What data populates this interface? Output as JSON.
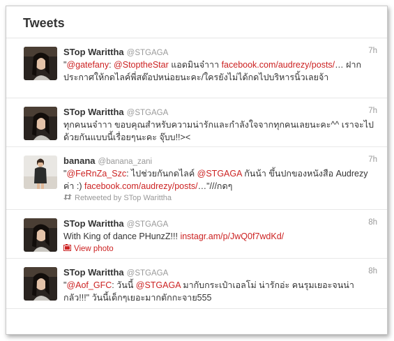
{
  "header": {
    "title": "Tweets"
  },
  "colors": {
    "link": "#cc2222",
    "text": "#333333",
    "muted": "#999999"
  },
  "tweets": [
    {
      "fullname": "STop Warittha",
      "username": "@STGAGA",
      "time": "7h",
      "avatar": "woman-portrait-dark",
      "parts": [
        {
          "t": "\"",
          "link": false
        },
        {
          "t": "@gatefany",
          "link": true
        },
        {
          "t": ": ",
          "link": false
        },
        {
          "t": "@StoptheStar",
          "link": true
        },
        {
          "t": " แอดมินจ๋าาา ",
          "link": false
        },
        {
          "t": "facebook.com/audrezy/posts/",
          "link": true
        },
        {
          "t": "… ฝากประกาศให้กดไลค์พี่สต๊อปหน่อยนะคะ/ใครยังไม่ได้กดไปบริหารนิ้วเลยจ้า",
          "link": false
        }
      ]
    },
    {
      "fullname": "STop Warittha",
      "username": "@STGAGA",
      "time": "7h",
      "avatar": "woman-portrait-dark",
      "parts": [
        {
          "t": "ทุกคนนจ๋าาา ขอบคุณสำหรับความน่ารักและกำลังใจจากทุกคนเลยนะคะ^^ เราจะไปด้วยกันแบบนี้เรื่อยๆนะคะ จุ๊บบ!!><",
          "link": false
        }
      ]
    },
    {
      "fullname": "banana",
      "username": "@banana_zani",
      "time": "7h",
      "avatar": "woman-standing",
      "parts": [
        {
          "t": "\"",
          "link": false
        },
        {
          "t": "@FeRnZa_Szc",
          "link": true
        },
        {
          "t": ": ไปช่วยกันกดไลค์ ",
          "link": false
        },
        {
          "t": "@STGAGA",
          "link": true
        },
        {
          "t": " กันน้า ขึ้นปกของหนังสือ Audrezy ค่า :) ",
          "link": false
        },
        {
          "t": "facebook.com/audrezy/posts/",
          "link": true
        },
        {
          "t": "…\"///กดๆ",
          "link": false
        }
      ],
      "meta": {
        "type": "retweet",
        "label": "Retweeted by STop Warittha",
        "icon": "retweet-icon"
      }
    },
    {
      "fullname": "STop Warittha",
      "username": "@STGAGA",
      "time": "8h",
      "avatar": "woman-portrait-dark",
      "parts": [
        {
          "t": "With King of dance PHunzZ!!! ",
          "link": false
        },
        {
          "t": "instagr.am/p/JwQ0f7wdKd/",
          "link": true
        }
      ],
      "meta": {
        "type": "photo",
        "label": "View photo",
        "icon": "photo-icon"
      }
    },
    {
      "fullname": "STop Warittha",
      "username": "@STGAGA",
      "time": "8h",
      "avatar": "woman-portrait-dark",
      "parts": [
        {
          "t": "\"",
          "link": false
        },
        {
          "t": "@Aof_GFC",
          "link": true
        },
        {
          "t": ": วันนี้ ",
          "link": false
        },
        {
          "t": "@STGAGA",
          "link": true
        },
        {
          "t": " มากับกระเป๋าเอลโม่ น่ารักอ่ะ คนรุมเยอะจนน่ากลัว!!!\" วันนี้เด็กๆเยอะมากตักกะจาย555",
          "link": false
        }
      ]
    }
  ]
}
